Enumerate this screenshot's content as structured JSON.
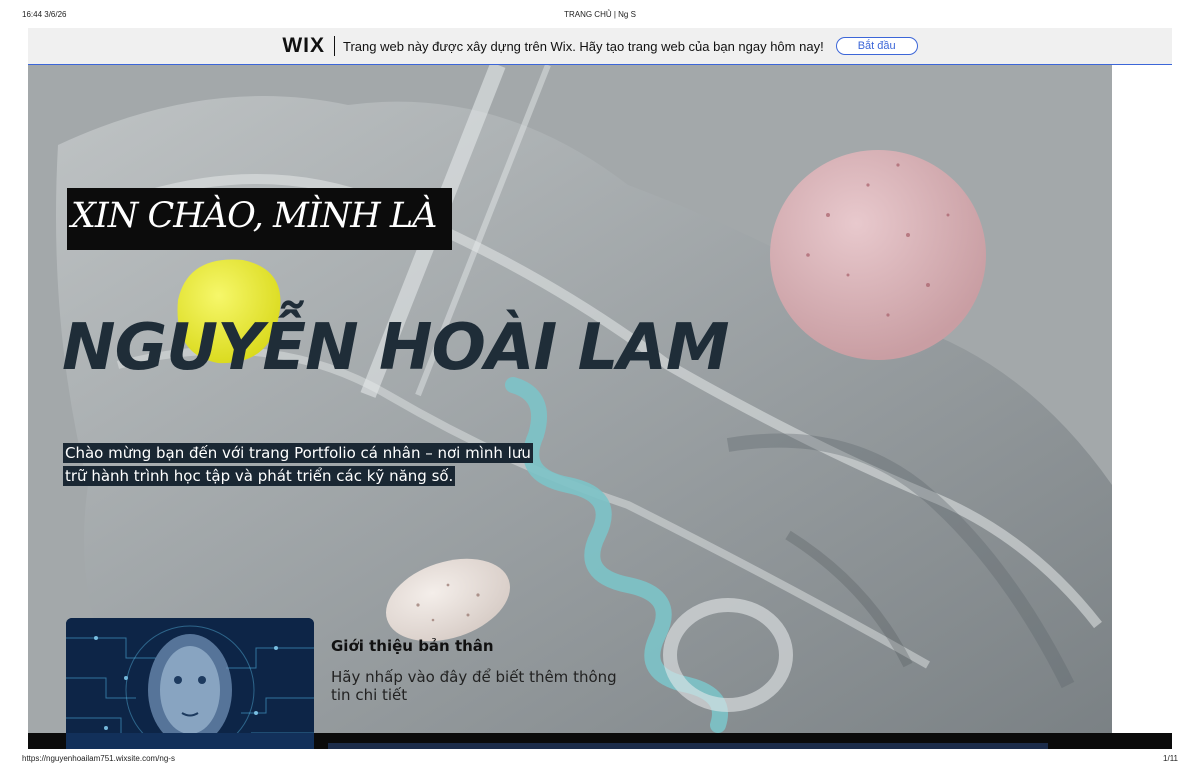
{
  "print_header": {
    "timestamp": "16:44 3/6/26",
    "page_title": "TRANG CHỦ | Ng S"
  },
  "wix_banner": {
    "logo": "WIX",
    "message": "Trang web này được xây dựng trên Wix. Hãy tạo trang web của bạn ngay hôm nay!",
    "button_label": "Bắt đầu",
    "accent_color": "#3c66d8"
  },
  "hero": {
    "greeting": "XIN CHÀO, MÌNH LÀ",
    "name": "NGUYỄN HOÀI LAM",
    "intro_line1": "Chào mừng bạn đến với trang Portfolio cá nhân – nơi mình lưu",
    "intro_line2": "trữ hành trình học tập và phát triển các kỹ năng số.",
    "name_color": "#1f2d38",
    "background_color": "#a3a8aa"
  },
  "about_card": {
    "title": "Giới thiệu bản thân",
    "description": "Hãy nhấp vào đây để biết thêm thông tin chi tiết",
    "image_icon": "ai-face-circuit-image"
  },
  "print_footer": {
    "url": "https://nguyenhoailam751.wixsite.com/ng-s",
    "page_number": "1/11"
  }
}
